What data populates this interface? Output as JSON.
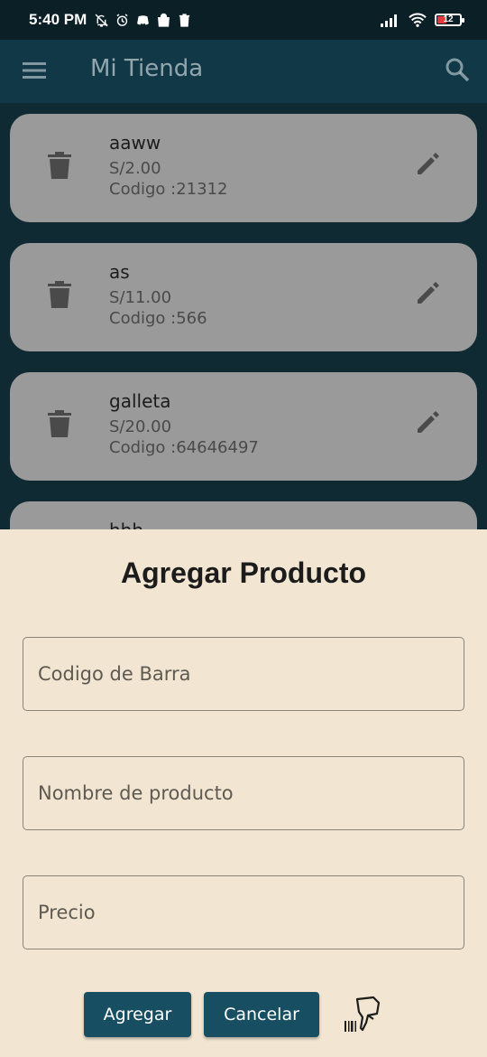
{
  "status_bar": {
    "time": "5:40 PM",
    "battery": "12"
  },
  "app_bar": {
    "title": "Mi Tienda",
    "menu_icon": "menu-icon",
    "search_icon": "search-icon"
  },
  "products": [
    {
      "name": "aaww",
      "price": "S/2.00",
      "code": "Codigo :21312"
    },
    {
      "name": "as",
      "price": "S/11.00",
      "code": "Codigo :566"
    },
    {
      "name": "galleta",
      "price": "S/20.00",
      "code": "Codigo :64646497"
    },
    {
      "name": "hhh",
      "price": "",
      "code": ""
    }
  ],
  "dialog": {
    "title": "Agregar Producto",
    "barcode_placeholder": "Codigo de Barra",
    "name_placeholder": "Nombre de producto",
    "price_placeholder": "Precio",
    "add_label": "Agregar",
    "cancel_label": "Cancelar",
    "scanner_icon": "barcode-scanner-icon"
  },
  "colors": {
    "app_bar": "#103847",
    "sheet_bg": "#f2e6d2",
    "button": "#174e61",
    "card": "#9a9a9a"
  }
}
